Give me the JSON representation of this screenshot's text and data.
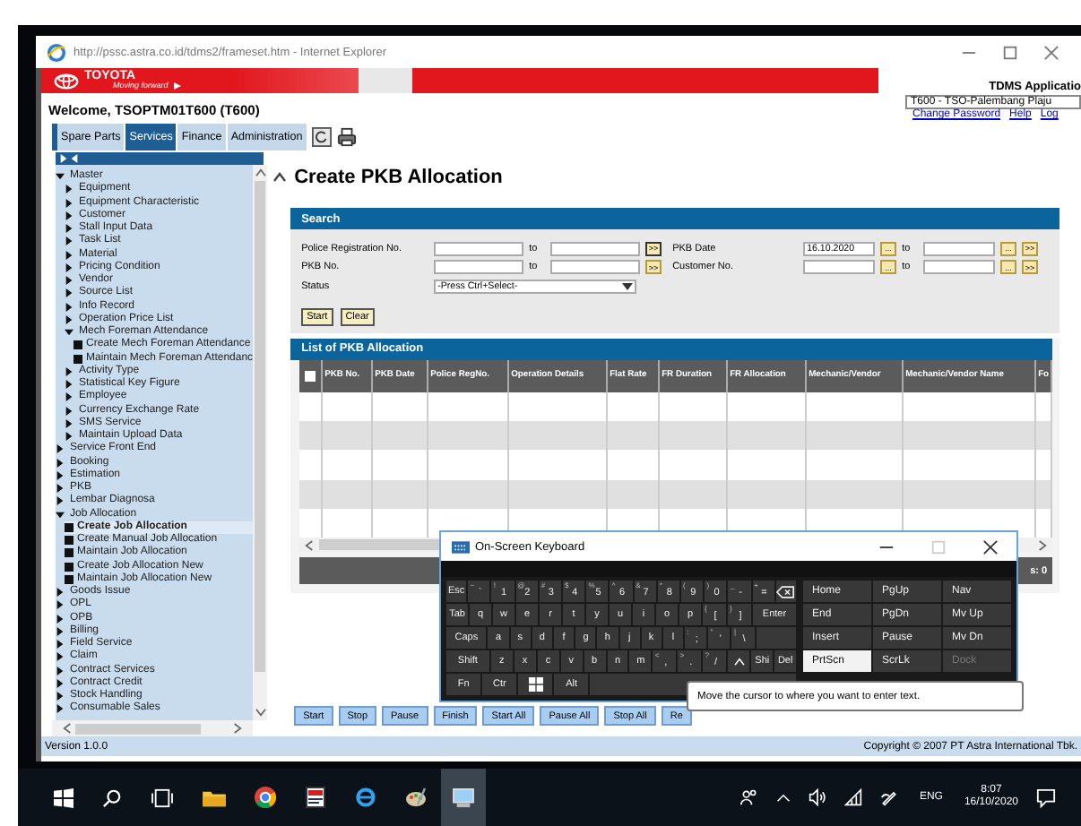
{
  "browser": {
    "title": "http://pssc.astra.co.id/tdms2/frameset.htm - Internet Explorer"
  },
  "header": {
    "brand": "TOYOTA",
    "tagline": "Moving forward",
    "app_title": "TDMS Applicatio"
  },
  "welcome": "Welcome, TSOPTM01T600 (T600)",
  "branch_select": {
    "value": "T600 - TSO-Palembang Plaju"
  },
  "links": [
    "Change Password",
    "Help",
    "Log"
  ],
  "tabs": [
    {
      "label": "Spare Parts",
      "selected": false
    },
    {
      "label": "Services",
      "selected": true
    },
    {
      "label": "Finance",
      "selected": false
    },
    {
      "label": "Administration",
      "selected": false
    }
  ],
  "sidebar": {
    "tree": [
      {
        "kind": "folder",
        "label": "Master",
        "expanded": true,
        "children": [
          {
            "kind": "folder",
            "label": "Equipment",
            "expanded": false
          },
          {
            "kind": "folder",
            "label": "Equipment Characteristic",
            "expanded": false
          },
          {
            "kind": "folder",
            "label": "Customer",
            "expanded": false
          },
          {
            "kind": "folder",
            "label": "Stall Input Data",
            "expanded": false
          },
          {
            "kind": "folder",
            "label": "Task List",
            "expanded": false
          },
          {
            "kind": "folder",
            "label": "Material",
            "expanded": false
          },
          {
            "kind": "folder",
            "label": "Pricing Condition",
            "expanded": false
          },
          {
            "kind": "folder",
            "label": "Vendor",
            "expanded": false
          },
          {
            "kind": "folder",
            "label": "Source List",
            "expanded": false
          },
          {
            "kind": "folder",
            "label": "Info Record",
            "expanded": false
          },
          {
            "kind": "folder",
            "label": "Operation Price List",
            "expanded": false
          },
          {
            "kind": "folder",
            "label": "Mech Foreman Attendance",
            "expanded": true,
            "children": [
              {
                "kind": "page",
                "label": "Create Mech Foreman Attendance",
                "selected": false
              },
              {
                "kind": "page",
                "label": "Maintain Mech Foreman Attendanc",
                "selected": false
              }
            ]
          },
          {
            "kind": "folder",
            "label": "Activity Type",
            "expanded": false
          },
          {
            "kind": "folder",
            "label": "Statistical Key Figure",
            "expanded": false
          },
          {
            "kind": "folder",
            "label": "Employee",
            "expanded": false
          },
          {
            "kind": "folder",
            "label": "Currency Exchange Rate",
            "expanded": false
          },
          {
            "kind": "folder",
            "label": "SMS Service",
            "expanded": false
          },
          {
            "kind": "folder",
            "label": "Maintain Upload Data",
            "expanded": false
          }
        ]
      },
      {
        "kind": "folder",
        "label": "Service Front End",
        "expanded": false
      },
      {
        "kind": "folder",
        "label": "Booking",
        "expanded": false
      },
      {
        "kind": "folder",
        "label": "Estimation",
        "expanded": false
      },
      {
        "kind": "folder",
        "label": "PKB",
        "expanded": false
      },
      {
        "kind": "folder",
        "label": "Lembar Diagnosa",
        "expanded": false
      },
      {
        "kind": "folder",
        "label": "Job Allocation",
        "expanded": true,
        "children": [
          {
            "kind": "page",
            "label": "Create Job Allocation",
            "selected": true
          },
          {
            "kind": "page",
            "label": "Create Manual Job Allocation",
            "selected": false
          },
          {
            "kind": "page",
            "label": "Maintain Job Allocation",
            "selected": false
          },
          {
            "kind": "page",
            "label": "Create Job Allocation New",
            "selected": false
          },
          {
            "kind": "page",
            "label": "Maintain Job Allocation New",
            "selected": false
          }
        ]
      },
      {
        "kind": "folder",
        "label": "Goods Issue",
        "expanded": false
      },
      {
        "kind": "folder",
        "label": "OPL",
        "expanded": false
      },
      {
        "kind": "folder",
        "label": "OPB",
        "expanded": false
      },
      {
        "kind": "folder",
        "label": "Billing",
        "expanded": false
      },
      {
        "kind": "folder",
        "label": "Field Service",
        "expanded": false
      },
      {
        "kind": "folder",
        "label": "Claim",
        "expanded": false
      },
      {
        "kind": "folder",
        "label": "Contract Services",
        "expanded": false
      },
      {
        "kind": "folder",
        "label": "Contract Credit",
        "expanded": false
      },
      {
        "kind": "folder",
        "label": "Stock Handling",
        "expanded": false
      },
      {
        "kind": "folder",
        "label": "Consumable Sales",
        "expanded": false
      }
    ]
  },
  "page_title": "Create PKB Allocation",
  "search": {
    "title": "Search",
    "left_fields": [
      {
        "label": "Police Registration No.",
        "to": "to",
        "more": ">>"
      },
      {
        "label": "PKB No.",
        "to": "to",
        "more": ">>"
      }
    ],
    "right_fields": [
      {
        "label": "PKB Date",
        "value": "16.10.2020",
        "picker": "...",
        "to": "to",
        "picker_to": "...",
        "more": ">>"
      },
      {
        "label": "Customer No.",
        "picker": "...",
        "to": "to",
        "picker_to": "...",
        "more": ">>"
      }
    ],
    "status": {
      "label": "Status",
      "value": "-Press Ctrl+Select-"
    },
    "buttons": [
      "Start",
      "Clear"
    ]
  },
  "list": {
    "title": "List of PKB Allocation",
    "select_all": {
      "checked": false
    },
    "columns": [
      "PKB No.",
      "PKB Date",
      "Police RegNo.",
      "Operation Details",
      "Flat Rate",
      "FR Duration",
      "FR Allocation",
      "Mechanic/Vendor",
      "Mechanic/Vendor Name",
      "Fo"
    ],
    "pager": "s: 0"
  },
  "action_buttons": [
    "Start",
    "Stop",
    "Pause",
    "Finish",
    "Start All",
    "Pause All",
    "Stop All",
    "Re"
  ],
  "footer": {
    "version": "Version 1.0.0",
    "copyright": "Copyright © 2007 PT Astra International Tbk."
  },
  "keyboard": {
    "title": "On-Screen Keyboard",
    "rows": [
      {
        "keys": [
          {
            "kind": "text",
            "label": "Esc"
          },
          {
            "kind": "dual",
            "label": "`",
            "shift": "~"
          },
          {
            "kind": "dual",
            "label": "1",
            "shift": "!"
          },
          {
            "kind": "dual",
            "label": "2",
            "shift": "@"
          },
          {
            "kind": "dual",
            "label": "3",
            "shift": "#"
          },
          {
            "kind": "dual",
            "label": "4",
            "shift": "$"
          },
          {
            "kind": "dual",
            "label": "5",
            "shift": "%"
          },
          {
            "kind": "dual",
            "label": "6",
            "shift": "^"
          },
          {
            "kind": "dual",
            "label": "7",
            "shift": "&"
          },
          {
            "kind": "dual",
            "label": "8",
            "shift": "*"
          },
          {
            "kind": "dual",
            "label": "9",
            "shift": "("
          },
          {
            "kind": "dual",
            "label": "0",
            "shift": ")"
          },
          {
            "kind": "dual",
            "label": "-",
            "shift": "_"
          },
          {
            "kind": "dual",
            "label": "=",
            "shift": "+"
          },
          {
            "kind": "backspace"
          }
        ]
      },
      {
        "keys": [
          {
            "kind": "text",
            "label": "Tab"
          },
          {
            "kind": "text",
            "label": "q"
          },
          {
            "kind": "text",
            "label": "w"
          },
          {
            "kind": "text",
            "label": "e"
          },
          {
            "kind": "text",
            "label": "r"
          },
          {
            "kind": "text",
            "label": "t"
          },
          {
            "kind": "text",
            "label": "y"
          },
          {
            "kind": "text",
            "label": "u"
          },
          {
            "kind": "text",
            "label": "i"
          },
          {
            "kind": "text",
            "label": "o"
          },
          {
            "kind": "text",
            "label": "p"
          },
          {
            "kind": "dual",
            "label": "[",
            "shift": "{"
          },
          {
            "kind": "dual",
            "label": "]",
            "shift": "}"
          },
          {
            "kind": "wide",
            "label": "Enter"
          }
        ]
      },
      {
        "keys": [
          {
            "kind": "wide",
            "label": "Caps"
          },
          {
            "kind": "text",
            "label": "a"
          },
          {
            "kind": "text",
            "label": "s"
          },
          {
            "kind": "text",
            "label": "d"
          },
          {
            "kind": "text",
            "label": "f"
          },
          {
            "kind": "text",
            "label": "g"
          },
          {
            "kind": "text",
            "label": "h"
          },
          {
            "kind": "text",
            "label": "j"
          },
          {
            "kind": "text",
            "label": "k"
          },
          {
            "kind": "text",
            "label": "l"
          },
          {
            "kind": "dual",
            "label": ";",
            "shift": ":"
          },
          {
            "kind": "dual",
            "label": "'",
            "shift": "\""
          },
          {
            "kind": "dual",
            "label": "\\",
            "shift": "|"
          },
          {
            "kind": "blank"
          }
        ]
      },
      {
        "keys": [
          {
            "kind": "wide",
            "label": "Shift"
          },
          {
            "kind": "text",
            "label": "z"
          },
          {
            "kind": "text",
            "label": "x"
          },
          {
            "kind": "text",
            "label": "c"
          },
          {
            "kind": "text",
            "label": "v"
          },
          {
            "kind": "text",
            "label": "b"
          },
          {
            "kind": "text",
            "label": "n"
          },
          {
            "kind": "text",
            "label": "m"
          },
          {
            "kind": "dual",
            "label": ",",
            "shift": "<"
          },
          {
            "kind": "dual",
            "label": ".",
            "shift": ">"
          },
          {
            "kind": "dual",
            "label": "/",
            "shift": "?"
          },
          {
            "kind": "up"
          },
          {
            "kind": "text",
            "label": "Shi"
          },
          {
            "kind": "text",
            "label": "Del"
          }
        ]
      },
      {
        "keys": [
          {
            "kind": "text",
            "label": "Fn"
          },
          {
            "kind": "text",
            "label": "Ctr"
          },
          {
            "kind": "windows"
          },
          {
            "kind": "text",
            "label": "Alt"
          },
          {
            "kind": "space"
          }
        ]
      }
    ],
    "nav_keys": [
      {
        "label": "Home",
        "selected": false,
        "disabled": false
      },
      {
        "label": "PgUp",
        "selected": false,
        "disabled": false
      },
      {
        "label": "Nav",
        "selected": false,
        "disabled": false
      },
      {
        "label": "End",
        "selected": false,
        "disabled": false
      },
      {
        "label": "PgDn",
        "selected": false,
        "disabled": false
      },
      {
        "label": "Mv Up",
        "selected": false,
        "disabled": false
      },
      {
        "label": "Insert",
        "selected": false,
        "disabled": false
      },
      {
        "label": "Pause",
        "selected": false,
        "disabled": false
      },
      {
        "label": "Mv Dn",
        "selected": false,
        "disabled": false
      },
      {
        "label": "PrtScn",
        "selected": true,
        "disabled": false
      },
      {
        "label": "ScrLk",
        "selected": false,
        "disabled": false
      },
      {
        "label": "Dock",
        "selected": false,
        "disabled": true
      }
    ],
    "tooltip": "Move the cursor to where you want to enter text."
  },
  "taskbar": {
    "language": "ENG",
    "time": "8:07",
    "date": "16/10/2020"
  }
}
